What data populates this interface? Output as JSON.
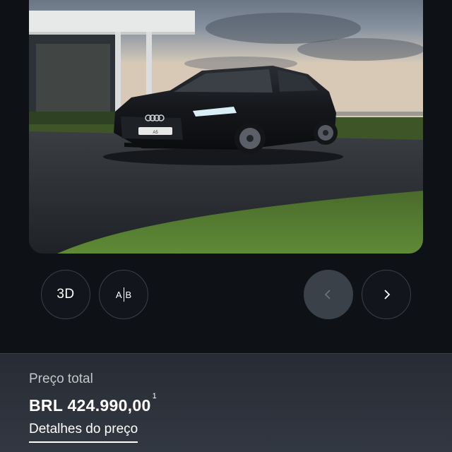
{
  "viewer": {
    "image_alt": "",
    "plate_text": "A5",
    "controls": {
      "three_d_label": "3D",
      "ab_left": "A",
      "ab_right": "B",
      "prev_icon": "chevron-left-icon",
      "next_icon": "chevron-right-icon",
      "prev_enabled": false
    }
  },
  "price": {
    "label": "Preço total",
    "value": "BRL 424.990,00",
    "footnote": "1",
    "details_link": "Detalhes do preço"
  },
  "colors": {
    "background": "#0e1116",
    "panel": "#2b3039",
    "control_border": "#3a4049",
    "disabled_control": "#3b4149"
  }
}
